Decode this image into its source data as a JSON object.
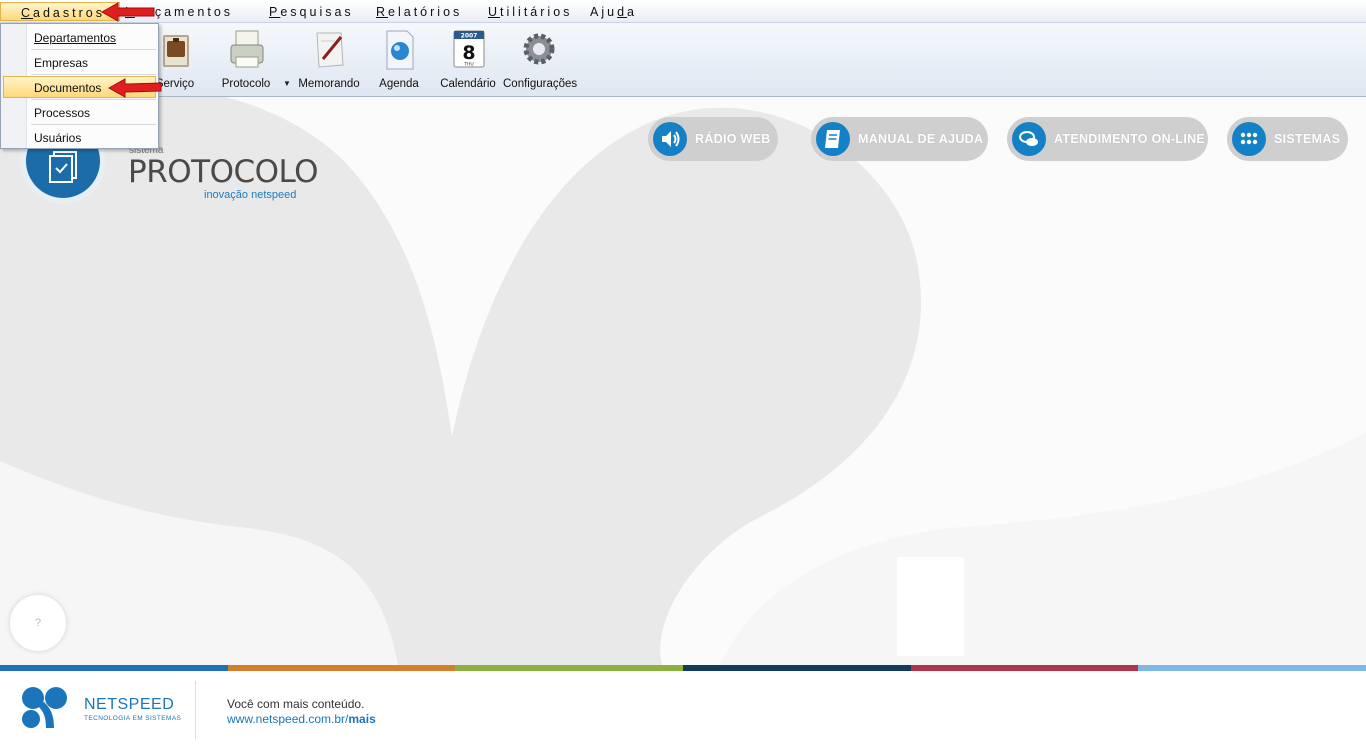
{
  "menubar": {
    "items": [
      {
        "label": "Cadastros",
        "accel": "C"
      },
      {
        "label": "Lançamentos",
        "accel": "L"
      },
      {
        "label": "Pesquisas",
        "accel": "P"
      },
      {
        "label": "Relatórios",
        "accel": "R"
      },
      {
        "label": "Utilitários",
        "accel": "U"
      },
      {
        "label": "Ajuda",
        "accel": "d"
      }
    ]
  },
  "toolbar": {
    "items": [
      {
        "label": "Serviço",
        "icon": "briefcase-icon"
      },
      {
        "label": "Protocolo",
        "icon": "printer-icon"
      },
      {
        "label": "Memorando",
        "icon": "pen-document-icon"
      },
      {
        "label": "Agenda",
        "icon": "globe-document-icon"
      },
      {
        "label": "Calendário",
        "icon": "calendar-icon",
        "calendar_day": "8",
        "calendar_year": "2007",
        "calendar_weekday": "THU"
      },
      {
        "label": "Configurações",
        "icon": "gear-icon"
      }
    ]
  },
  "dropdown": {
    "items": [
      {
        "label": "Departamentos"
      },
      {
        "label": "Empresas"
      },
      {
        "label": "Documentos",
        "highlighted": true
      },
      {
        "label": "Processos"
      },
      {
        "label": "Usuários"
      }
    ]
  },
  "header_buttons": [
    {
      "label": "RÁDIO WEB",
      "icon": "speaker-icon"
    },
    {
      "label": "MANUAL DE AJUDA",
      "icon": "book-icon"
    },
    {
      "label": "ATENDIMENTO ON-LINE",
      "icon": "chat-icon"
    },
    {
      "label": "SISTEMAS",
      "icon": "grid-dots-icon"
    }
  ],
  "logo": {
    "small": "sistema",
    "main": "PROTOCOLO",
    "tagline": "inovação netspeed"
  },
  "help_button": {
    "label": "?"
  },
  "strip_colors": [
    "#1e73b8",
    "#d4802a",
    "#8bb13e",
    "#133c5c",
    "#b2344c",
    "#7eb8e4"
  ],
  "footer": {
    "brand": "NETSPEED",
    "brand_sub": "TECNOLOGIA EM SISTEMAS",
    "line1": "Você com mais conteúdo.",
    "link_prefix": "www.netspeed.com.br/",
    "link_bold": "mais"
  },
  "colors": {
    "accent_blue": "#1480c6",
    "pill_gray": "#cfcfcf",
    "menu_highlight": "#ffd978",
    "annotation_arrow": "#e21d1d"
  }
}
